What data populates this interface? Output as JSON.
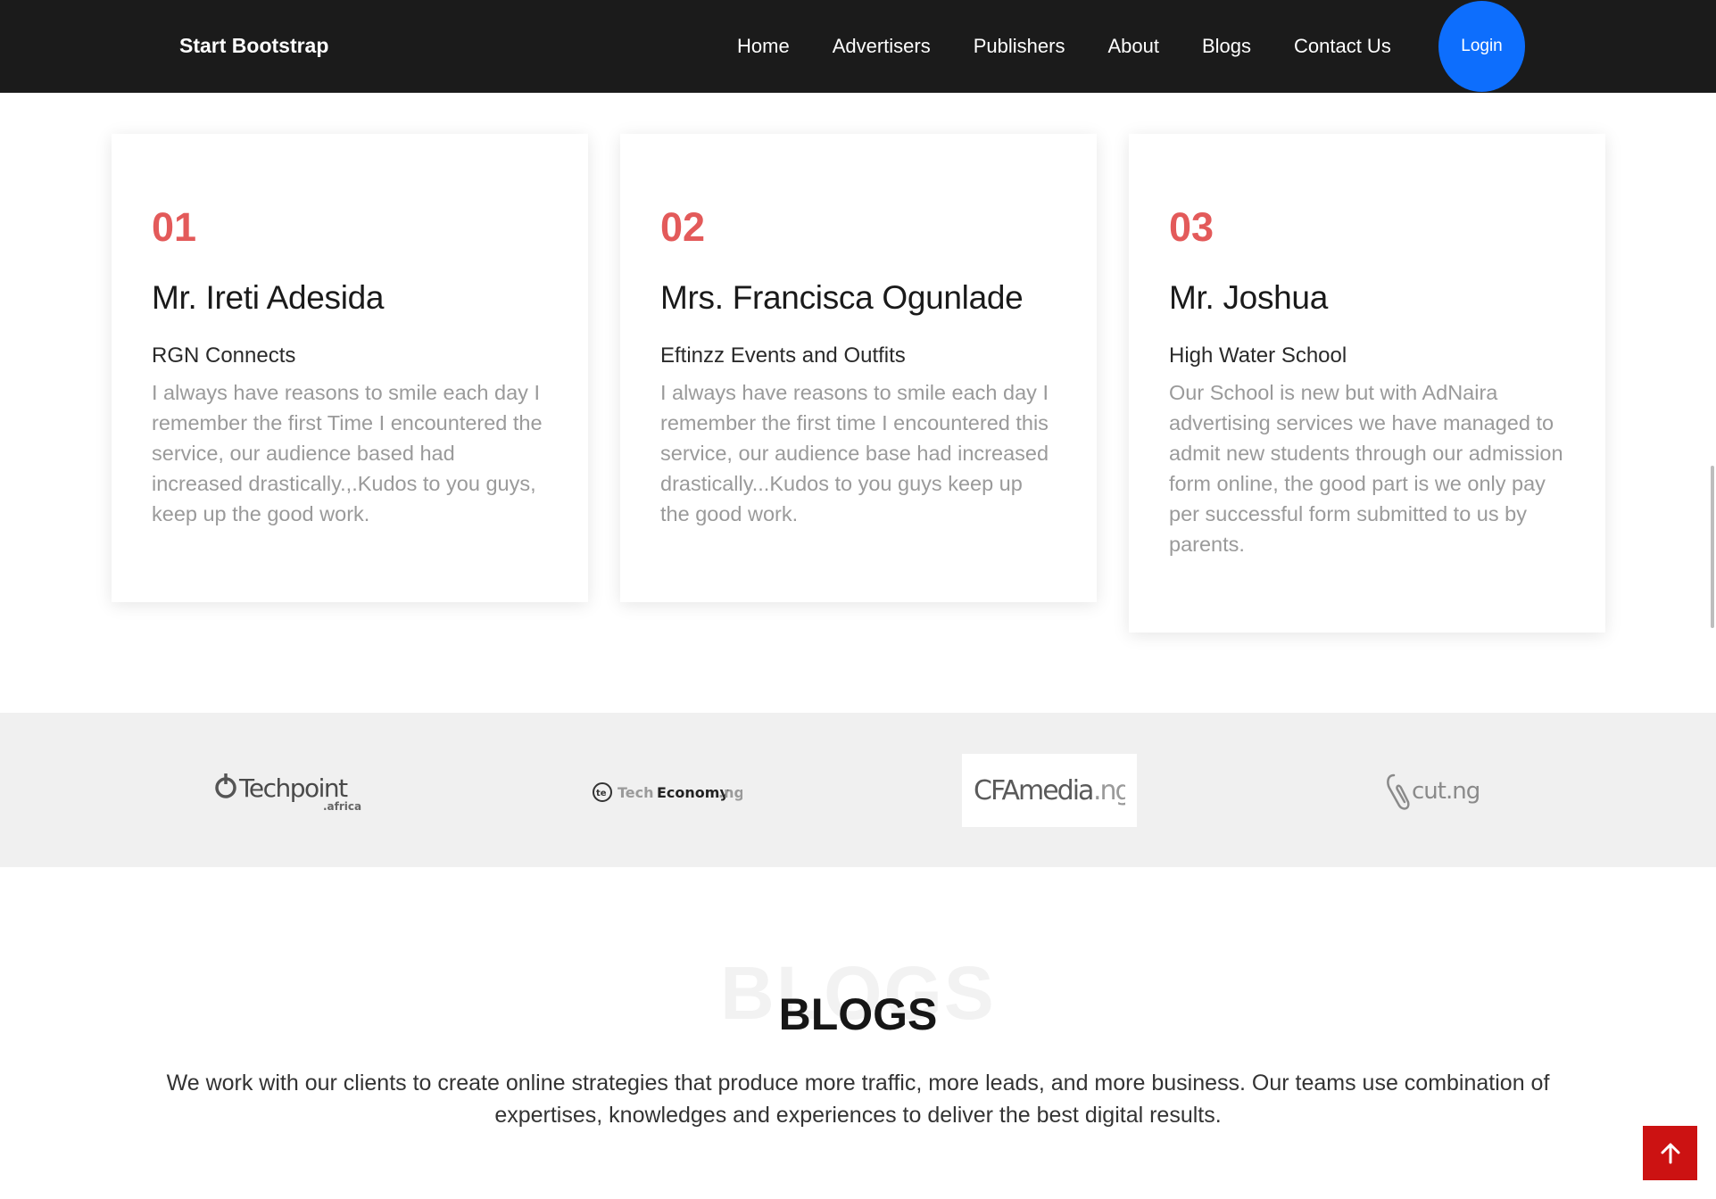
{
  "navbar": {
    "brand": "Start Bootstrap",
    "links": [
      "Home",
      "Advertisers",
      "Publishers",
      "About",
      "Blogs",
      "Contact Us"
    ],
    "login_label": "Login",
    "login_color": "#0d6efd",
    "background": "#1b1b1b"
  },
  "testimonials": [
    {
      "number": "01",
      "name": "Mr. Ireti Adesida",
      "company": "RGN Connects",
      "text": "I always have reasons to smile each day I remember the first Time I encountered the service, our audience based had increased drastically.,.Kudos to you guys, keep up the good work."
    },
    {
      "number": "02",
      "name": "Mrs. Francisca Ogunlade",
      "company": "Eftinzz Events and Outfits",
      "text": "I always have reasons to smile each day I remember the first time I encountered this service, our audience base had increased drastically...Kudos to you guys keep up the good work."
    },
    {
      "number": "03",
      "name": "Mr. Joshua",
      "company": "High Water School",
      "text": "Our School is new but with AdNaira advertising services we have managed to admit new students through our admission form online, the good part is we only pay per successful form submitted to us by parents."
    }
  ],
  "accent_color": "#e35a5a",
  "partners": {
    "techpoint": {
      "name": "Techpoint",
      "suffix": ".africa",
      "icon": "power-icon"
    },
    "techeconomy": {
      "prefix": "Tech",
      "name": "Economy",
      "suffix": ".ng",
      "icon": "te-circle-icon"
    },
    "cfamedia": {
      "name": "CFAmedia",
      "suffix": ".ng"
    },
    "cutng": {
      "name": "cut.ng",
      "icon": "paperclip-icon"
    }
  },
  "blogs": {
    "bg_title": "BLOGS",
    "title": "BLOGS",
    "description": "We work with our clients to create online strategies that produce more traffic, more leads, and more business. Our teams use combination of expertises, knowledges and experiences to deliver the best digital results."
  },
  "scroll_top": {
    "icon": "arrow-up-icon",
    "color": "#cc1212"
  }
}
